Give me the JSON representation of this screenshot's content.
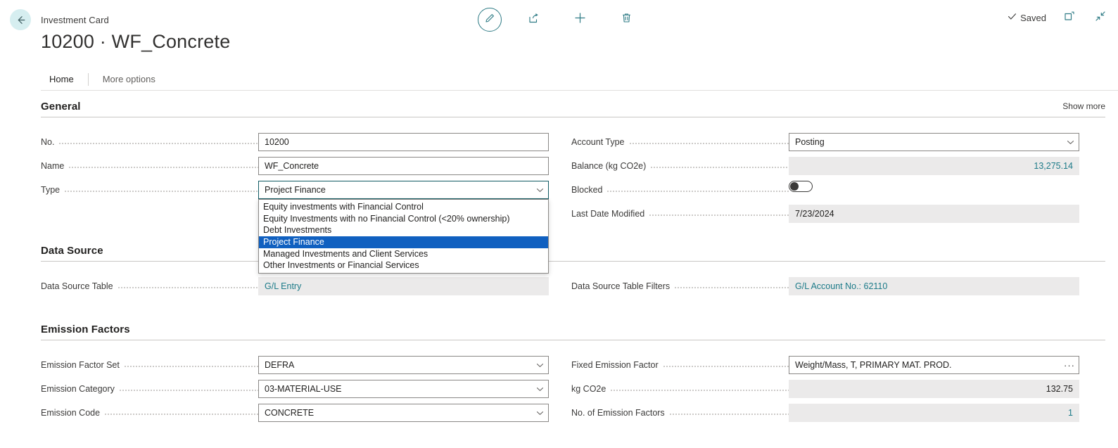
{
  "header": {
    "back_icon": "back-arrow-icon",
    "breadcrumb": "Investment Card",
    "title": "10200 · WF_Concrete",
    "actions": [
      {
        "name": "edit",
        "icon": "pencil-icon",
        "label": "Edit"
      },
      {
        "name": "share",
        "icon": "share-icon",
        "label": "Share"
      },
      {
        "name": "new",
        "icon": "plus-icon",
        "label": "New"
      },
      {
        "name": "delete",
        "icon": "trash-icon",
        "label": "Delete"
      }
    ],
    "saved_label": "Saved",
    "saved_icon": "checkmark-icon",
    "open_new_window_icon": "open-in-new-window-icon",
    "collapse_icon": "collapse-arrows-icon"
  },
  "ribbon": {
    "tabs": [
      {
        "label": "Home",
        "active": true
      },
      {
        "label": "More options",
        "active": false
      }
    ]
  },
  "general": {
    "title": "General",
    "show_more": "Show more",
    "fields_left": [
      {
        "label": "No.",
        "value": "10200",
        "type": "text"
      },
      {
        "label": "Name",
        "value": "WF_Concrete",
        "type": "text"
      },
      {
        "label": "Type",
        "value": "Project Finance",
        "type": "combo-open"
      }
    ],
    "fields_right": [
      {
        "label": "Account Type",
        "value": "Posting",
        "type": "combo"
      },
      {
        "label": "Balance (kg CO2e)",
        "value": "13,275.14",
        "type": "readonly-link-right"
      },
      {
        "label": "Blocked",
        "value": "",
        "type": "toggle",
        "checked": false
      },
      {
        "label": "Last Date Modified",
        "value": "7/23/2024",
        "type": "readonly"
      }
    ],
    "type_dropdown": {
      "options": [
        "Equity investments with Financial Control",
        "Equity Investments with no Financial Control (<20% ownership)",
        "Debt Investments",
        "Project Finance",
        "Managed Investments and Client Services",
        "Other Investments or Financial Services"
      ],
      "selected_index": 3
    }
  },
  "data_source": {
    "title": "Data Source",
    "fields_left": [
      {
        "label": "Data Source Table",
        "value": "G/L Entry",
        "type": "readonly-link"
      }
    ],
    "fields_right": [
      {
        "label": "Data Source Table Filters",
        "value": "G/L Account No.: 62110",
        "type": "readonly-link"
      }
    ]
  },
  "emission_factors": {
    "title": "Emission Factors",
    "fields_left": [
      {
        "label": "Emission Factor Set",
        "value": "DEFRA",
        "type": "combo"
      },
      {
        "label": "Emission Category",
        "value": "03-MATERIAL-USE",
        "type": "combo"
      },
      {
        "label": "Emission Code",
        "value": "CONCRETE",
        "type": "combo"
      }
    ],
    "fields_right": [
      {
        "label": "Fixed Emission Factor",
        "value": "Weight/Mass, T, PRIMARY MAT. PROD.",
        "type": "assist"
      },
      {
        "label": "kg CO2e",
        "value": "132.75",
        "type": "readonly-right"
      },
      {
        "label": "No. of Emission Factors",
        "value": "1",
        "type": "readonly-link-right"
      }
    ],
    "assist_glyph": "···"
  },
  "colors": {
    "accent_teal": "#2e7b85",
    "link_teal": "#1b7a88",
    "select_blue": "#1060c0",
    "back_circle": "#d6eef0",
    "readonly_bg": "#ebeaea",
    "field_border": "#8a8886",
    "active_border": "#105b63"
  }
}
